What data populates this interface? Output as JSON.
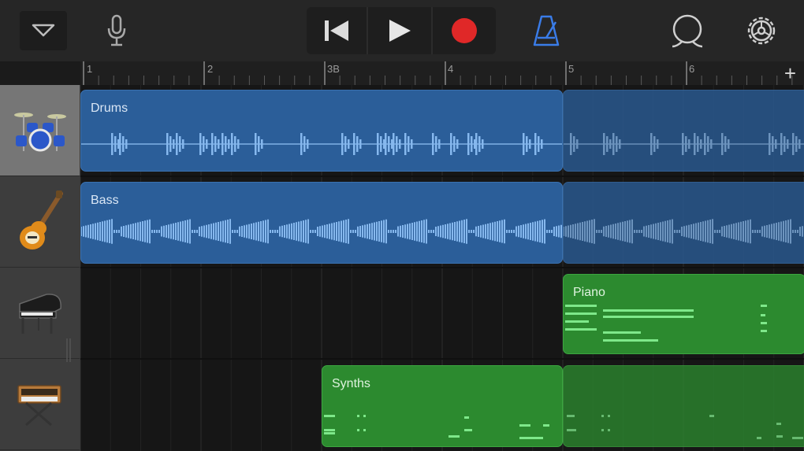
{
  "toolbar": {
    "icons": [
      "chevron-down-icon",
      "microphone-icon",
      "rewind-icon",
      "play-icon",
      "record-icon",
      "metronome-icon",
      "loop-icon",
      "settings-icon"
    ],
    "accent_color": "#3a7ce8",
    "record_color": "#e02828"
  },
  "ruler": {
    "bars": [
      "1",
      "2",
      "3B",
      "4",
      "5",
      "6"
    ],
    "add_symbol": "+"
  },
  "tracks": [
    {
      "name": "Drums",
      "icon": "drum-kit-icon",
      "selected": true,
      "color": "#2b5e99"
    },
    {
      "name": "Bass",
      "icon": "bass-guitar-icon",
      "selected": false,
      "color": "#2b5e99"
    },
    {
      "name": "Piano",
      "icon": "grand-piano-icon",
      "selected": false,
      "color": "#2c8a2f"
    },
    {
      "name": "Synths",
      "icon": "synthesizer-icon",
      "selected": false,
      "color": "#2c8a2f"
    }
  ]
}
